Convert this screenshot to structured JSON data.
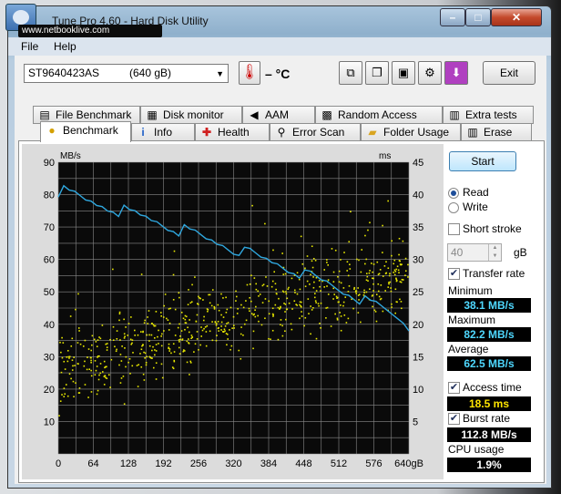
{
  "window": {
    "title": "Tune Pro 4.60 - Hard Disk Utility",
    "watermark": "www.netbooklive.com",
    "min": "–",
    "max": "□",
    "close": "✕"
  },
  "menu": [
    "File",
    "Help"
  ],
  "toolbar": {
    "drive": "ST9640423AS",
    "drive_size": "(640 gB)",
    "temp": "– °C",
    "exit": "Exit",
    "icons": [
      "copy-info-icon",
      "copy-screenshot-icon",
      "save-icon",
      "options-icon",
      "download-icon"
    ]
  },
  "tabs_top": [
    {
      "label": "File Benchmark",
      "icon": "file-benchmark-icon"
    },
    {
      "label": "Disk monitor",
      "icon": "disk-monitor-icon"
    },
    {
      "label": "AAM",
      "icon": "speaker-icon"
    },
    {
      "label": "Random Access",
      "icon": "random-access-icon"
    },
    {
      "label": "Extra tests",
      "icon": "extra-tests-icon"
    }
  ],
  "tabs_bottom": [
    {
      "label": "Benchmark",
      "icon": "lightbulb-icon"
    },
    {
      "label": "Info",
      "icon": "info-icon"
    },
    {
      "label": "Health",
      "icon": "health-cross-icon"
    },
    {
      "label": "Error Scan",
      "icon": "magnifier-icon"
    },
    {
      "label": "Folder Usage",
      "icon": "folder-icon"
    },
    {
      "label": "Erase",
      "icon": "trash-icon"
    }
  ],
  "side": {
    "start": "Start",
    "read": "Read",
    "write": "Write",
    "short_stroke": "Short stroke",
    "stroke_value": "40",
    "gb": "gB",
    "transfer_rate": "Transfer rate",
    "minimum_label": "Minimum",
    "minimum": "38.1 MB/s",
    "maximum_label": "Maximum",
    "maximum": "82.2 MB/s",
    "average_label": "Average",
    "average": "62.5 MB/s",
    "access_time": "Access time",
    "access_value": "18.5 ms",
    "burst_rate": "Burst rate",
    "burst_value": "112.8 MB/s",
    "cpu_label": "CPU usage",
    "cpu_value": "1.9%",
    "read_selected": true,
    "short_stroke_checked": false,
    "transfer_checked": true,
    "access_checked": true,
    "burst_checked": true
  },
  "chart_data": {
    "type": "line",
    "left_unit": "MB/s",
    "right_unit": "ms",
    "y_left_ticks": [
      90,
      80,
      70,
      60,
      50,
      40,
      30,
      20,
      10
    ],
    "y_right_ticks": [
      45,
      40,
      35,
      30,
      25,
      20,
      15,
      10,
      5
    ],
    "x_ticks": [
      "0",
      "64",
      "128",
      "192",
      "256",
      "320",
      "384",
      "448",
      "512",
      "576",
      "640gB"
    ],
    "xlim": [
      0,
      640
    ],
    "ylim_left": [
      0,
      90
    ],
    "ylim_right": [
      0,
      45
    ],
    "colors": {
      "transfer": "#2fa7de",
      "access": "#e8e800",
      "plot_bg": "#0a0a0a",
      "grid": "#8a8a8a"
    },
    "series": [
      {
        "type": "line",
        "x": [
          0,
          10,
          20,
          30,
          40,
          50,
          60,
          70,
          80,
          90,
          100,
          110,
          120,
          130,
          140,
          150,
          160,
          170,
          180,
          190,
          200,
          210,
          220,
          230,
          240,
          250,
          260,
          270,
          280,
          290,
          300,
          310,
          320,
          330,
          340,
          350,
          360,
          370,
          380,
          390,
          400,
          410,
          420,
          430,
          440,
          450,
          460,
          470,
          480,
          490,
          500,
          510,
          520,
          530,
          540,
          550,
          560,
          570,
          580,
          590,
          600,
          610,
          620,
          630,
          640
        ],
        "values": [
          81,
          81,
          80,
          80,
          79,
          78,
          78,
          77,
          77,
          76,
          76,
          75,
          75,
          74,
          74,
          73,
          73,
          72,
          72,
          71,
          70,
          70,
          69,
          69,
          68,
          68,
          67,
          66,
          66,
          65,
          65,
          64,
          63,
          63,
          62,
          62,
          61,
          60,
          60,
          59,
          59,
          58,
          57,
          57,
          56,
          55,
          55,
          54,
          53,
          53,
          52,
          51,
          50,
          50,
          49,
          48,
          47,
          46,
          46,
          45,
          44,
          43,
          42,
          41,
          39
        ]
      },
      {
        "type": "scatter",
        "name": "Access time",
        "trend_ms": [
          [
            0,
            13
          ],
          [
            320,
            21
          ],
          [
            640,
            28
          ]
        ]
      }
    ]
  }
}
